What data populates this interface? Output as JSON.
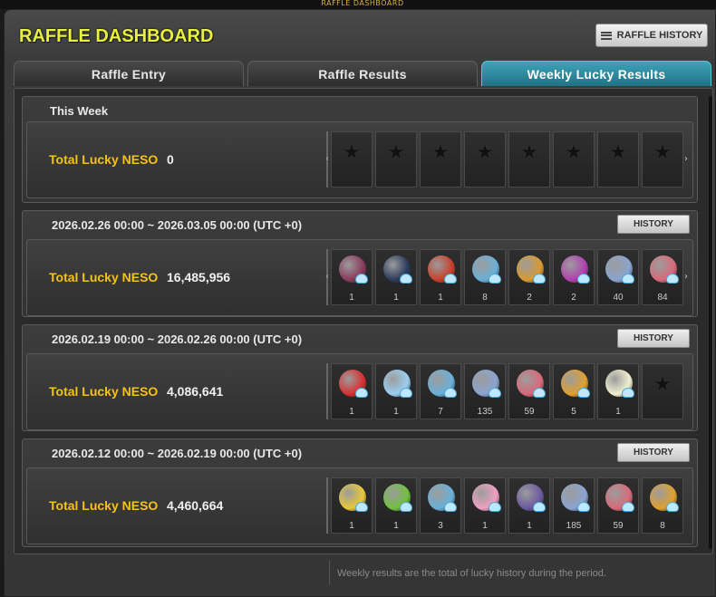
{
  "window_label": "RAFFLE DASHBOARD",
  "title": "RAFFLE DASHBOARD",
  "history_button": "RAFFLE HISTORY",
  "tabs": [
    {
      "label": "Raffle Entry",
      "active": false
    },
    {
      "label": "Raffle Results",
      "active": false
    },
    {
      "label": "Weekly Lucky Results",
      "active": true
    }
  ],
  "this_week": {
    "heading": "This Week",
    "neso_label": "Total Lucky NESO",
    "neso_value": "0",
    "slots": 8
  },
  "weeks": [
    {
      "period": "2026.02.26 00:00 ~ 2026.03.05 00:00 (UTC +0)",
      "history_label": "HISTORY",
      "neso_label": "Total Lucky NESO",
      "neso_value": "16,485,956",
      "items": [
        {
          "icon": "character-icon",
          "qty": "1",
          "color": "#8a3a5a"
        },
        {
          "icon": "dark-blade-icon",
          "qty": "1",
          "color": "#2a3a5a"
        },
        {
          "icon": "flame-helm-icon",
          "qty": "1",
          "color": "#c8402a"
        },
        {
          "icon": "cat-box-icon",
          "qty": "8",
          "color": "#6ab0d8"
        },
        {
          "icon": "emblem-icon",
          "qty": "2",
          "color": "#d89a30"
        },
        {
          "icon": "pink-orb-icon",
          "qty": "2",
          "color": "#b040b0"
        },
        {
          "icon": "blue-coin-icon",
          "qty": "40",
          "color": "#8aa4d0"
        },
        {
          "icon": "red-coin-icon",
          "qty": "84",
          "color": "#d86a7a"
        }
      ]
    },
    {
      "period": "2026.02.19 00:00 ~ 2026.02.26 00:00 (UTC +0)",
      "history_label": "HISTORY",
      "neso_label": "Total Lucky NESO",
      "neso_value": "4,086,641",
      "items": [
        {
          "icon": "jester-icon",
          "qty": "1",
          "color": "#d83030"
        },
        {
          "icon": "ice-crystal-icon",
          "qty": "1",
          "color": "#9ad0f0"
        },
        {
          "icon": "cat-box-icon",
          "qty": "7",
          "color": "#6ab0d8"
        },
        {
          "icon": "blue-coin-icon",
          "qty": "135",
          "color": "#8aa4d0"
        },
        {
          "icon": "red-coin-icon",
          "qty": "59",
          "color": "#d86a7a"
        },
        {
          "icon": "gold-coin-icon",
          "qty": "5",
          "color": "#e0a030"
        },
        {
          "icon": "ghost-icon",
          "qty": "1",
          "color": "#f0f0d0"
        }
      ],
      "empty_slots": 1
    },
    {
      "period": "2026.02.12 00:00 ~ 2026.02.19 00:00 (UTC +0)",
      "history_label": "HISTORY",
      "neso_label": "Total Lucky NESO",
      "neso_value": "4,460,664",
      "items": [
        {
          "icon": "banana-icon",
          "qty": "1",
          "color": "#e8c838"
        },
        {
          "icon": "green-battery-icon",
          "qty": "1",
          "color": "#70c040"
        },
        {
          "icon": "cat-box-icon",
          "qty": "3",
          "color": "#6ab0d8"
        },
        {
          "icon": "pink-pig-icon",
          "qty": "1",
          "color": "#f0a0c0"
        },
        {
          "icon": "dark-crest-icon",
          "qty": "1",
          "color": "#6a5aa0"
        },
        {
          "icon": "blue-coin-icon",
          "qty": "185",
          "color": "#8aa4d0"
        },
        {
          "icon": "red-coin-icon",
          "qty": "59",
          "color": "#d86a7a"
        },
        {
          "icon": "gold-coin-icon",
          "qty": "8",
          "color": "#e0a030"
        }
      ]
    }
  ],
  "footer_note": "Weekly results are the total of lucky history during the period."
}
